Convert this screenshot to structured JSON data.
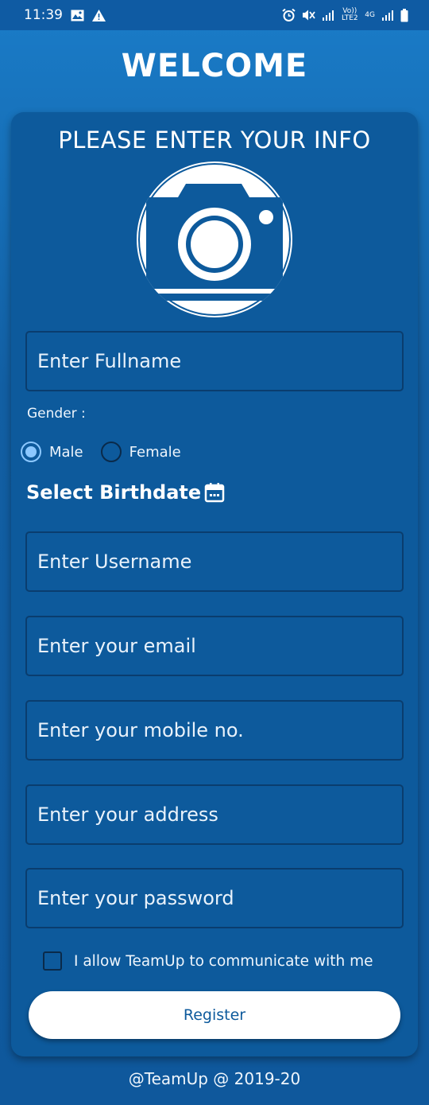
{
  "status_bar": {
    "time": "11:39",
    "network_label_1": "Vo)) LTE2",
    "network_label_2": "4G",
    "icons": [
      "image-icon",
      "alert-icon",
      "alarm-icon",
      "mute-icon",
      "signal-icon",
      "battery-icon"
    ]
  },
  "header": {
    "title": "WELCOME"
  },
  "form": {
    "title": "PLEASE ENTER YOUR INFO",
    "fullname_placeholder": "Enter Fullname",
    "gender_label": "Gender :",
    "gender_options": [
      {
        "label": "Male",
        "selected": true
      },
      {
        "label": "Female",
        "selected": false
      }
    ],
    "birthdate_label": "Select Birthdate",
    "username_placeholder": "Enter Username",
    "email_placeholder": "Enter your email",
    "mobile_placeholder": "Enter your mobile no.",
    "address_placeholder": "Enter your address",
    "password_placeholder": "Enter your password",
    "consent_label": "I allow TeamUp to communicate with me",
    "consent_checked": false,
    "register_label": "Register"
  },
  "footer": {
    "text": "@TeamUp @ 2019-20"
  },
  "colors": {
    "background": "#1566ae",
    "card": "#0d5a9c",
    "field_border": "#0a3d6e",
    "radio_accent": "#8cc8ff",
    "button_bg": "#ffffff"
  }
}
